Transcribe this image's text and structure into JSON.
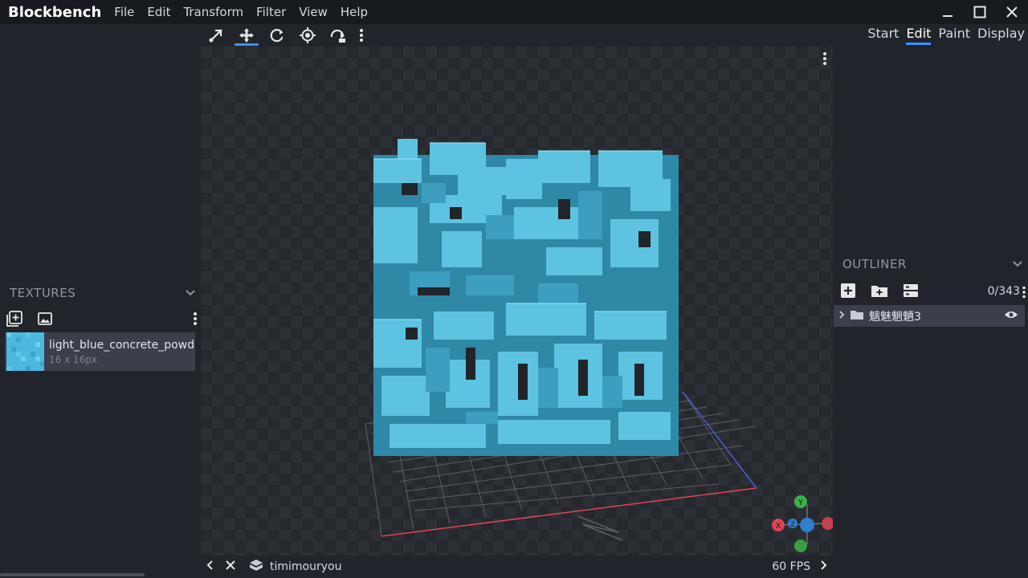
{
  "app": {
    "title": "Blockbench"
  },
  "menu": [
    "File",
    "Edit",
    "Transform",
    "Filter",
    "View",
    "Help"
  ],
  "modes": {
    "items": [
      "Start",
      "Edit",
      "Paint",
      "Display"
    ],
    "active": "Edit"
  },
  "toolbar": {
    "tools": [
      "vertex-snap-tool",
      "move-tool",
      "rotate-tool",
      "pivot-tool",
      "bend-tool"
    ],
    "active": "move-tool"
  },
  "textures": {
    "header": "TEXTURES",
    "items": [
      {
        "name": "light_blue_concrete_powder",
        "size": "16 x 16px"
      }
    ]
  },
  "outliner": {
    "header": "OUTLINER",
    "count": "0/343",
    "items": [
      {
        "name": "魑魅魍魉3"
      }
    ]
  },
  "status": {
    "user": "timimouryou",
    "fps": "60 FPS"
  },
  "gizmo": {
    "labels": [
      "Y",
      "X",
      "Z"
    ]
  },
  "colors": {
    "accent": "#3e90ff",
    "model_light": "#5ec3e0",
    "model_dark": "#2f88a6",
    "axis_x": "#e04356",
    "axis_y": "#3fb049",
    "axis_z": "#2f7fd1"
  }
}
